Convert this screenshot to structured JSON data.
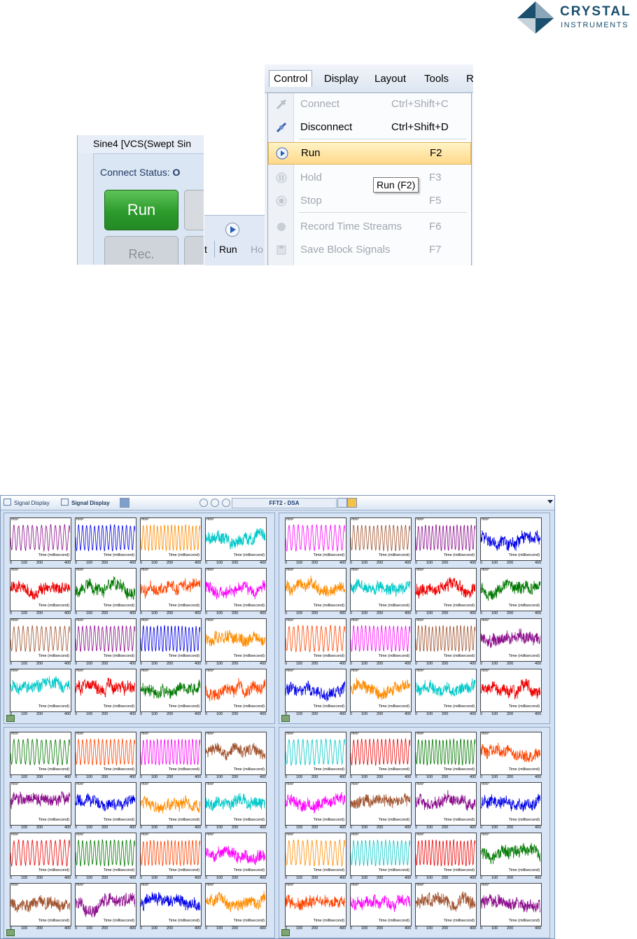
{
  "logo": {
    "line1": "CRYSTAL",
    "line2": "INSTRUMENTS",
    "color": "#1a4f6e"
  },
  "shot1": {
    "window_title": "Sine4 [VCS(Swept Sin",
    "connect_status_label": "Connect Status:",
    "connect_status_value": "O",
    "run_label": "Run",
    "rec_label": "Rec."
  },
  "shot2": {
    "left_text": "t",
    "run_label": "Run",
    "hold_fragment": "Ho"
  },
  "menu": {
    "bar": [
      "Control",
      "Display",
      "Layout",
      "Tools",
      "R"
    ],
    "items": [
      {
        "label": "Connect",
        "shortcut": "Ctrl+Shift+C",
        "enabled": false,
        "icon": "connect-icon"
      },
      {
        "label": "Disconnect",
        "shortcut": "Ctrl+Shift+D",
        "enabled": true,
        "icon": "disconnect-icon"
      },
      {
        "label": "Run",
        "shortcut": "F2",
        "enabled": true,
        "highlighted": true,
        "icon": "run-icon"
      },
      {
        "label": "Hold",
        "shortcut": "F3",
        "enabled": false,
        "icon": "hold-icon"
      },
      {
        "label": "Stop",
        "shortcut": "F5",
        "enabled": false,
        "icon": "stop-icon"
      },
      {
        "label": "Record Time Streams",
        "shortcut": "F6",
        "enabled": false,
        "icon": "record-icon"
      },
      {
        "label": "Save Block Signals",
        "shortcut": "F7",
        "enabled": false,
        "icon": "save-icon"
      }
    ],
    "tooltip": "Run (F2)"
  },
  "signal_display": {
    "tabs": [
      "Signal Display",
      "Signal Display"
    ],
    "title": "FFT2 - DSA",
    "plot_unit": "m/s²",
    "plot_xlabel": "Time (millisecond)",
    "tick_labels": [
      "0",
      "100",
      "200",
      "400"
    ],
    "colors": {
      "purple": "#8b0d8b",
      "blue": "#0000e8",
      "orange": "#ff8c00",
      "cyan": "#00c8c8",
      "red": "#ee0000",
      "green": "#007800",
      "orangered": "#ff4500",
      "magenta": "#ff00ff",
      "brown": "#a0522d"
    },
    "quadrants": [
      {
        "plots": [
          {
            "color": "purple",
            "kind": "periodic"
          },
          {
            "color": "blue",
            "kind": "periodic"
          },
          {
            "color": "orange",
            "kind": "periodic"
          },
          {
            "color": "cyan",
            "kind": "noise"
          },
          {
            "color": "red",
            "kind": "noise"
          },
          {
            "color": "green",
            "kind": "noise"
          },
          {
            "color": "orangered",
            "kind": "noise"
          },
          {
            "color": "magenta",
            "kind": "noise"
          },
          {
            "color": "brown",
            "kind": "periodic"
          },
          {
            "color": "purple",
            "kind": "periodic"
          },
          {
            "color": "blue",
            "kind": "periodic"
          },
          {
            "color": "orange",
            "kind": "noise"
          },
          {
            "color": "cyan",
            "kind": "noise"
          },
          {
            "color": "red",
            "kind": "noise"
          },
          {
            "color": "green",
            "kind": "noise"
          },
          {
            "color": "orangered",
            "kind": "noise"
          }
        ]
      },
      {
        "plots": [
          {
            "color": "magenta",
            "kind": "periodic"
          },
          {
            "color": "brown",
            "kind": "periodic"
          },
          {
            "color": "purple",
            "kind": "periodic"
          },
          {
            "color": "blue",
            "kind": "noise"
          },
          {
            "color": "orange",
            "kind": "noise"
          },
          {
            "color": "cyan",
            "kind": "noise"
          },
          {
            "color": "red",
            "kind": "noise"
          },
          {
            "color": "green",
            "kind": "noise"
          },
          {
            "color": "orangered",
            "kind": "periodic"
          },
          {
            "color": "magenta",
            "kind": "periodic"
          },
          {
            "color": "brown",
            "kind": "periodic"
          },
          {
            "color": "purple",
            "kind": "noise"
          },
          {
            "color": "blue",
            "kind": "noise"
          },
          {
            "color": "orange",
            "kind": "noise"
          },
          {
            "color": "cyan",
            "kind": "noise"
          },
          {
            "color": "red",
            "kind": "noise"
          }
        ]
      },
      {
        "plots": [
          {
            "color": "green",
            "kind": "periodic"
          },
          {
            "color": "orangered",
            "kind": "periodic"
          },
          {
            "color": "magenta",
            "kind": "periodic"
          },
          {
            "color": "brown",
            "kind": "noise"
          },
          {
            "color": "purple",
            "kind": "noise"
          },
          {
            "color": "blue",
            "kind": "noise"
          },
          {
            "color": "orange",
            "kind": "noise"
          },
          {
            "color": "cyan",
            "kind": "noise"
          },
          {
            "color": "red",
            "kind": "periodic"
          },
          {
            "color": "green",
            "kind": "periodic"
          },
          {
            "color": "orangered",
            "kind": "periodic"
          },
          {
            "color": "magenta",
            "kind": "noise"
          },
          {
            "color": "brown",
            "kind": "noise"
          },
          {
            "color": "purple",
            "kind": "noise"
          },
          {
            "color": "blue",
            "kind": "noise"
          },
          {
            "color": "orange",
            "kind": "noise"
          }
        ]
      },
      {
        "plots": [
          {
            "color": "cyan",
            "kind": "periodic"
          },
          {
            "color": "red",
            "kind": "periodic"
          },
          {
            "color": "green",
            "kind": "periodic"
          },
          {
            "color": "orangered",
            "kind": "noise"
          },
          {
            "color": "magenta",
            "kind": "noise"
          },
          {
            "color": "brown",
            "kind": "noise"
          },
          {
            "color": "purple",
            "kind": "noise"
          },
          {
            "color": "blue",
            "kind": "noise"
          },
          {
            "color": "orange",
            "kind": "periodic"
          },
          {
            "color": "cyan",
            "kind": "periodic"
          },
          {
            "color": "red",
            "kind": "periodic"
          },
          {
            "color": "green",
            "kind": "noise"
          },
          {
            "color": "orangered",
            "kind": "noise"
          },
          {
            "color": "magenta",
            "kind": "noise"
          },
          {
            "color": "brown",
            "kind": "noise"
          },
          {
            "color": "purple",
            "kind": "noise"
          }
        ]
      }
    ]
  }
}
